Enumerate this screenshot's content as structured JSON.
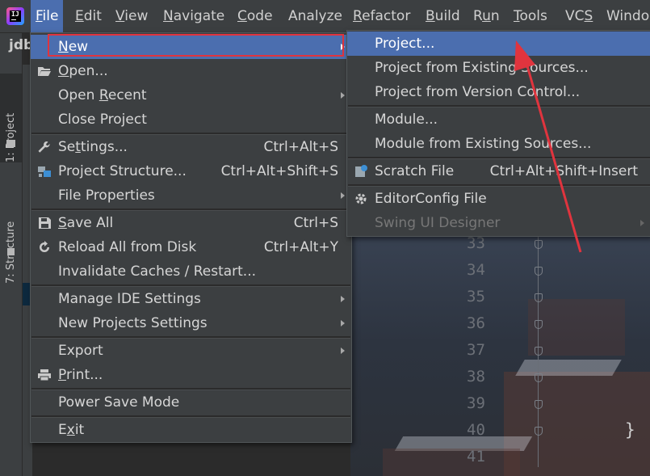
{
  "menubar": {
    "items": [
      {
        "label": "File",
        "mnemonic": "F",
        "rest": "ile"
      },
      {
        "label": "Edit",
        "mnemonic": "E",
        "rest": "dit"
      },
      {
        "label": "View",
        "mnemonic": "V",
        "rest": "iew"
      },
      {
        "label": "Navigate",
        "mnemonic": "N",
        "rest": "avigate"
      },
      {
        "label": "Code",
        "mnemonic": "C",
        "rest": "ode"
      },
      {
        "label": "Analyze",
        "mnemonic": "",
        "rest": "Analyze"
      },
      {
        "label": "Refactor",
        "mnemonic": "R",
        "rest": "efactor"
      },
      {
        "label": "Build",
        "mnemonic": "B",
        "rest": "uild"
      },
      {
        "label": "Run",
        "pre": "R",
        "mnemonic": "u",
        "rest": "n"
      },
      {
        "label": "Tools",
        "mnemonic": "T",
        "rest": "ools"
      },
      {
        "label": "VCS",
        "pre": "VC",
        "mnemonic": "S",
        "rest": ""
      },
      {
        "label": "Window",
        "pre": "",
        "mnemonic": "",
        "rest": "Windo"
      }
    ]
  },
  "project_tab": "jdb",
  "left_strip": {
    "project_tab": "1: Project",
    "structure_tab": "7: Structure"
  },
  "file_menu": {
    "items": [
      {
        "label": "New",
        "pre": "",
        "mn": "N",
        "post": "ew",
        "shortcut": "",
        "submenu": true
      },
      {
        "label": "Open...",
        "pre": "",
        "mn": "O",
        "post": "pen...",
        "shortcut": "",
        "icon": "folder-icon"
      },
      {
        "label": "Open Recent",
        "pre": "Open ",
        "mn": "R",
        "post": "ecent",
        "shortcut": "",
        "submenu": true
      },
      {
        "label": "Close Project",
        "pre": "Close Project",
        "mn": "",
        "post": "",
        "shortcut": ""
      },
      {
        "label": "Settings...",
        "pre": "Se",
        "mn": "t",
        "post": "tings...",
        "shortcut": "Ctrl+Alt+S",
        "icon": "wrench-icon"
      },
      {
        "label": "Project Structure...",
        "pre": "Project Structure...",
        "mn": "",
        "post": "",
        "shortcut": "Ctrl+Alt+Shift+S",
        "icon": "project-structure-icon"
      },
      {
        "label": "File Properties",
        "pre": "File Properties",
        "mn": "",
        "post": "",
        "shortcut": "",
        "submenu": true
      },
      {
        "label": "Save All",
        "pre": "",
        "mn": "S",
        "post": "ave All",
        "shortcut": "Ctrl+S",
        "icon": "save-icon"
      },
      {
        "label": "Reload All from Disk",
        "pre": "Reload All from Disk",
        "mn": "",
        "post": "",
        "shortcut": "Ctrl+Alt+Y",
        "icon": "reload-icon"
      },
      {
        "label": "Invalidate Caches / Restart...",
        "pre": "Invalidate Caches / Restart...",
        "mn": "",
        "post": "",
        "shortcut": ""
      },
      {
        "label": "Manage IDE Settings",
        "pre": "Manage IDE Settings",
        "mn": "",
        "post": "",
        "shortcut": "",
        "submenu": true
      },
      {
        "label": "New Projects Settings",
        "pre": "New Projects Settings",
        "mn": "",
        "post": "",
        "shortcut": "",
        "submenu": true
      },
      {
        "label": "Export",
        "pre": "Export",
        "mn": "",
        "post": "",
        "shortcut": "",
        "submenu": true
      },
      {
        "label": "Print...",
        "pre": "",
        "mn": "P",
        "post": "rint...",
        "shortcut": "",
        "icon": "print-icon"
      },
      {
        "label": "Power Save Mode",
        "pre": "Power Save Mode",
        "mn": "",
        "post": "",
        "shortcut": ""
      },
      {
        "label": "Exit",
        "pre": "E",
        "mn": "x",
        "post": "it",
        "shortcut": ""
      }
    ]
  },
  "new_submenu": {
    "items": [
      {
        "label": "Project...",
        "shortcut": ""
      },
      {
        "label": "Project from Existing Sources...",
        "shortcut": ""
      },
      {
        "label": "Project from Version Control...",
        "shortcut": ""
      },
      {
        "label": "Module...",
        "shortcut": ""
      },
      {
        "label": "Module from Existing Sources...",
        "shortcut": ""
      },
      {
        "label": "Scratch File",
        "shortcut": "Ctrl+Alt+Shift+Insert",
        "icon": "scratch-file-icon"
      },
      {
        "label": "EditorConfig File",
        "shortcut": "",
        "icon": "gear-icon"
      },
      {
        "label": "Swing UI Designer",
        "shortcut": "",
        "disabled": true,
        "submenu": true
      }
    ]
  },
  "editor": {
    "line_numbers": [
      "33",
      "34",
      "35",
      "36",
      "37",
      "38",
      "39",
      "40",
      "41"
    ],
    "closing_brace": "}"
  },
  "colors": {
    "menu_bg": "#3c3f41",
    "highlight": "#4b6eaf",
    "annotation_red": "#e0343e"
  }
}
